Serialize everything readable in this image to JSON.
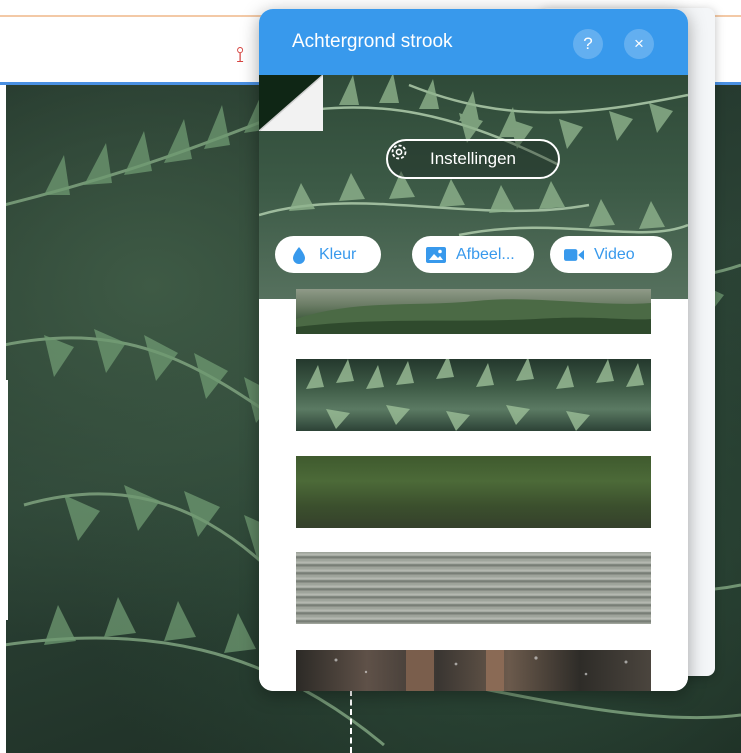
{
  "panel": {
    "title": "Achtergrond strook",
    "help_label": "?",
    "close_label": "×",
    "settings_label": "Instellingen",
    "media_buttons": [
      {
        "label": "Kleur",
        "icon": "drop-icon"
      },
      {
        "label": "Afbeel...",
        "icon": "image-icon"
      },
      {
        "label": "Video",
        "icon": "video-camera-icon"
      }
    ],
    "thumbnails": [
      {
        "name": "mountains"
      },
      {
        "name": "ferns"
      },
      {
        "name": "moss-texture"
      },
      {
        "name": "corrugated-metal"
      },
      {
        "name": "forest-trees"
      }
    ]
  },
  "colors": {
    "panel_header": "#3899ec",
    "accent": "#3899ec",
    "editor_line": "#4a90e2"
  }
}
